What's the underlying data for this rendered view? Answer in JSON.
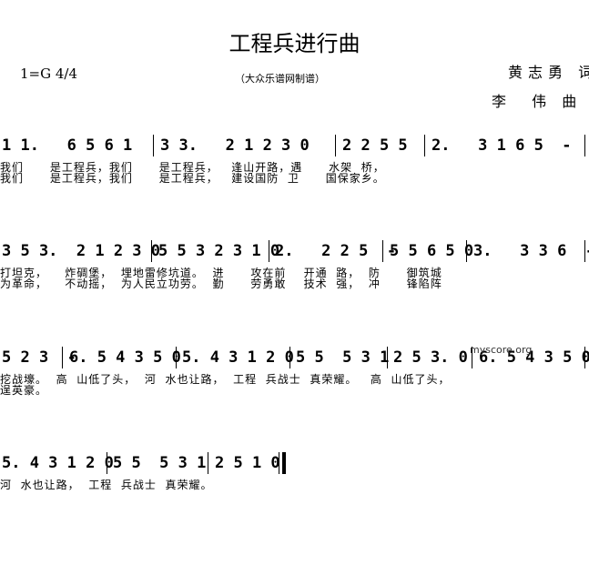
{
  "title": "工程兵进行曲",
  "key": "1=G 4/4",
  "source": "（大众乐谱网制谱）",
  "lyricist": "黄志勇 词",
  "composer": "李  伟 曲",
  "watermark": "myscore.org",
  "rows": [
    {
      "measures": [
        "1 1.   6 5 6 1",
        "3 3.   2 1 2 3 0",
        "2 2 5 5",
        "2.   3 1 6 5  -"
      ],
      "lyrics": [
        "我们      是工程兵，我们      是工程兵，   逢山开路，遇      水架  桥，",
        "我们      是工程兵，我们      是工程兵，   建设国防  卫      国保家乡。"
      ]
    },
    {
      "measures": [
        "3 5 3.  2 1 2 3 0",
        "5 5 3 2 3 1 0",
        "2.   2 2 5  -",
        "5 5 6 5 0",
        "3.   3 3 6  -"
      ],
      "lyrics": [
        "打坦克，    炸碉堡，  埋地雷修坑道。  进      攻在前    开通  路，  防      御筑城",
        "为革命，    不动摇，  为人民立功劳。  勤      劳勇敢    技术  强，  冲      锋陷阵"
      ]
    },
    {
      "measures": [
        "5 2 3  -",
        "6. 5 4 3 5 0",
        "5. 4 3 1 2 0",
        "5 5  5 3 1",
        "2 5 3. 0",
        "6. 5 4 3 5 0"
      ],
      "lyrics": [
        "挖战壕。  高  山低了头，  河  水也让路，  工程  兵战士  真荣耀。   高  山低了头，",
        "逞英豪。"
      ]
    },
    {
      "measures": [
        "5. 4 3 1 2 0",
        "5 5  5 3 1",
        "2 5 1 0"
      ],
      "lyrics": [
        "河  水也让路，  工程  兵战士  真荣耀。"
      ]
    }
  ]
}
